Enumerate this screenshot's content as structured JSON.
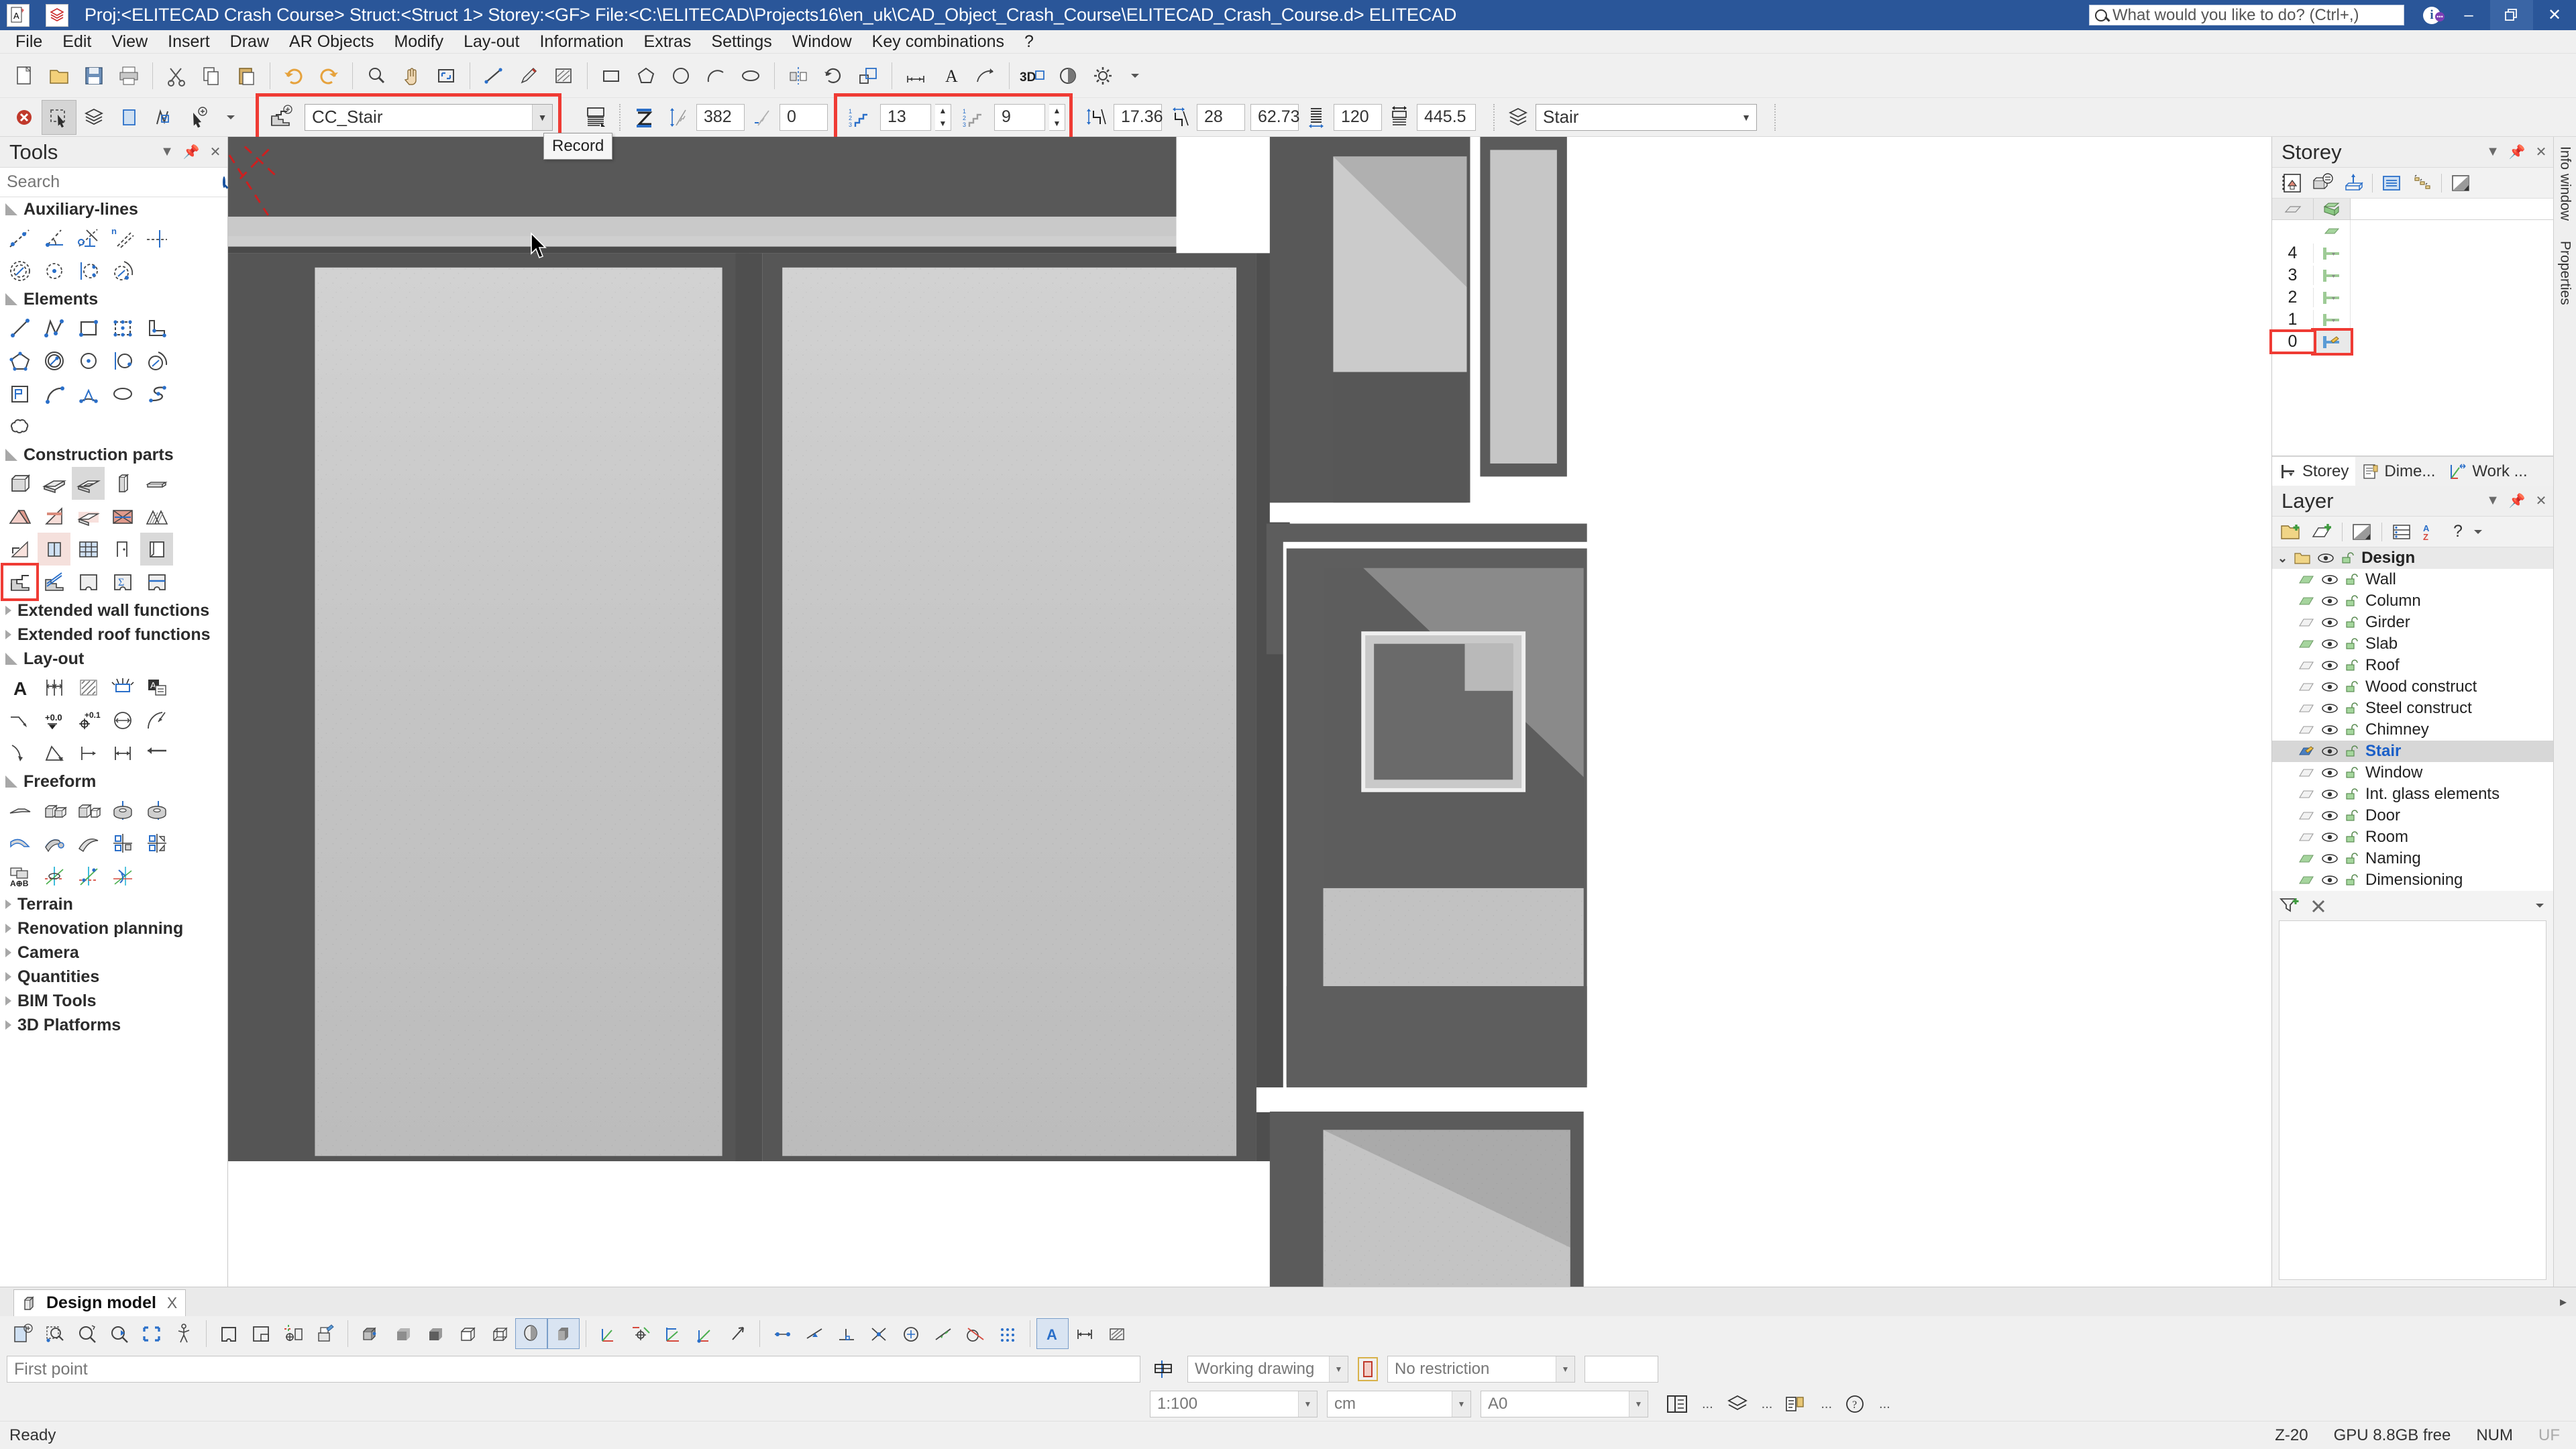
{
  "titlebar": {
    "project_label": "Proj:<ELITECAD Crash Course>",
    "struct_label": "Struct:<Struct 1>",
    "storey_label": "Storey:<GF>",
    "file_label": "File:<C:\\ELITECAD\\Projects16\\en_uk\\CAD_Object_Crash_Course\\ELITECAD_Crash_Course.d>",
    "app_label": "ELITECAD",
    "full_title": "Proj:<ELITECAD Crash Course> Struct:<Struct 1>  Storey:<GF>  File:<C:\\ELITECAD\\Projects16\\en_uk\\CAD_Object_Crash_Course\\ELITECAD_Crash_Course.d> ELITECAD",
    "search_placeholder": "What would you like to do? (Ctrl+,)",
    "minimize": "–",
    "restore": "❐",
    "close": "✕",
    "accent_color": "#2a5699"
  },
  "menu": {
    "items": [
      "File",
      "Edit",
      "View",
      "Insert",
      "Draw",
      "AR Objects",
      "Modify",
      "Lay-out",
      "Information",
      "Extras",
      "Settings",
      "Window",
      "Key combinations",
      "?"
    ]
  },
  "toolbar2": {
    "object_name": "CC_Stair",
    "tooltip": "Record",
    "fields": [
      {
        "name": "total-rise",
        "value": "382"
      },
      {
        "name": "offset",
        "value": "0"
      },
      {
        "name": "risers",
        "value": "13"
      },
      {
        "name": "treads",
        "value": "9"
      },
      {
        "name": "riser-height",
        "value": "17.36"
      },
      {
        "name": "tread-depth",
        "value": "28"
      },
      {
        "name": "walking-line",
        "value": "62.73"
      },
      {
        "name": "stair-width",
        "value": "120"
      },
      {
        "name": "stair-length",
        "value": "445.5"
      }
    ],
    "layer_value": "Stair"
  },
  "tools_panel": {
    "title": "Tools",
    "search_placeholder": "Search",
    "groups": [
      {
        "label": "Auxiliary-lines",
        "open": true,
        "rows": 2
      },
      {
        "label": "Elements",
        "open": true,
        "rows": 3
      },
      {
        "label": "Construction parts",
        "open": true,
        "rows": 4
      },
      {
        "label": "Extended wall functions",
        "open": false,
        "rows": 0
      },
      {
        "label": "Extended roof functions",
        "open": false,
        "rows": 0
      },
      {
        "label": "Lay-out",
        "open": true,
        "rows": 3
      },
      {
        "label": "Freeform",
        "open": true,
        "rows": 3
      },
      {
        "label": "Terrain",
        "open": false,
        "rows": 0
      },
      {
        "label": "Renovation planning",
        "open": false,
        "rows": 0
      },
      {
        "label": "Camera",
        "open": false,
        "rows": 0
      },
      {
        "label": "Quantities",
        "open": false,
        "rows": 0
      },
      {
        "label": "BIM Tools",
        "open": false,
        "rows": 0
      },
      {
        "label": "3D Platforms",
        "open": false,
        "rows": 0
      }
    ]
  },
  "storey_panel": {
    "title": "Storey",
    "rows": [
      "4",
      "3",
      "2",
      "1",
      "0"
    ],
    "selected": "0",
    "tabs": [
      {
        "label": "Storey",
        "active": true
      },
      {
        "label": "Dime...",
        "active": false
      },
      {
        "label": "Work ...",
        "active": false
      }
    ]
  },
  "layer_panel": {
    "title": "Layer",
    "sort_label": "A\nZ",
    "help_label": "?",
    "group": "Design",
    "layers": [
      {
        "name": "Wall",
        "filled": true
      },
      {
        "name": "Column",
        "filled": true
      },
      {
        "name": "Girder",
        "filled": false
      },
      {
        "name": "Slab",
        "filled": true
      },
      {
        "name": "Roof",
        "filled": false
      },
      {
        "name": "Wood construct",
        "filled": false
      },
      {
        "name": "Steel construct",
        "filled": false
      },
      {
        "name": "Chimney",
        "filled": false
      },
      {
        "name": "Stair",
        "filled": true,
        "selected": true
      },
      {
        "name": "Window",
        "filled": false
      },
      {
        "name": "Int. glass elements",
        "filled": false
      },
      {
        "name": "Door",
        "filled": false
      },
      {
        "name": "Room",
        "filled": false
      },
      {
        "name": "Naming",
        "filled": true
      },
      {
        "name": "Dimensioning",
        "filled": true
      }
    ]
  },
  "vertical_tabs": [
    "Info window",
    "Properties"
  ],
  "doc_tabs": [
    {
      "label": "Design model",
      "close": "X",
      "active": true
    }
  ],
  "command_line": {
    "placeholder": "First point",
    "drawing_type": "Working drawing",
    "restriction": "No restriction",
    "scale": "1:100",
    "unit": "cm",
    "paper": "A0"
  },
  "statusbar": {
    "state": "Ready",
    "zoom": "Z-20",
    "gpu": "GPU 8.8GB free",
    "num": "NUM",
    "uf": "UF"
  }
}
